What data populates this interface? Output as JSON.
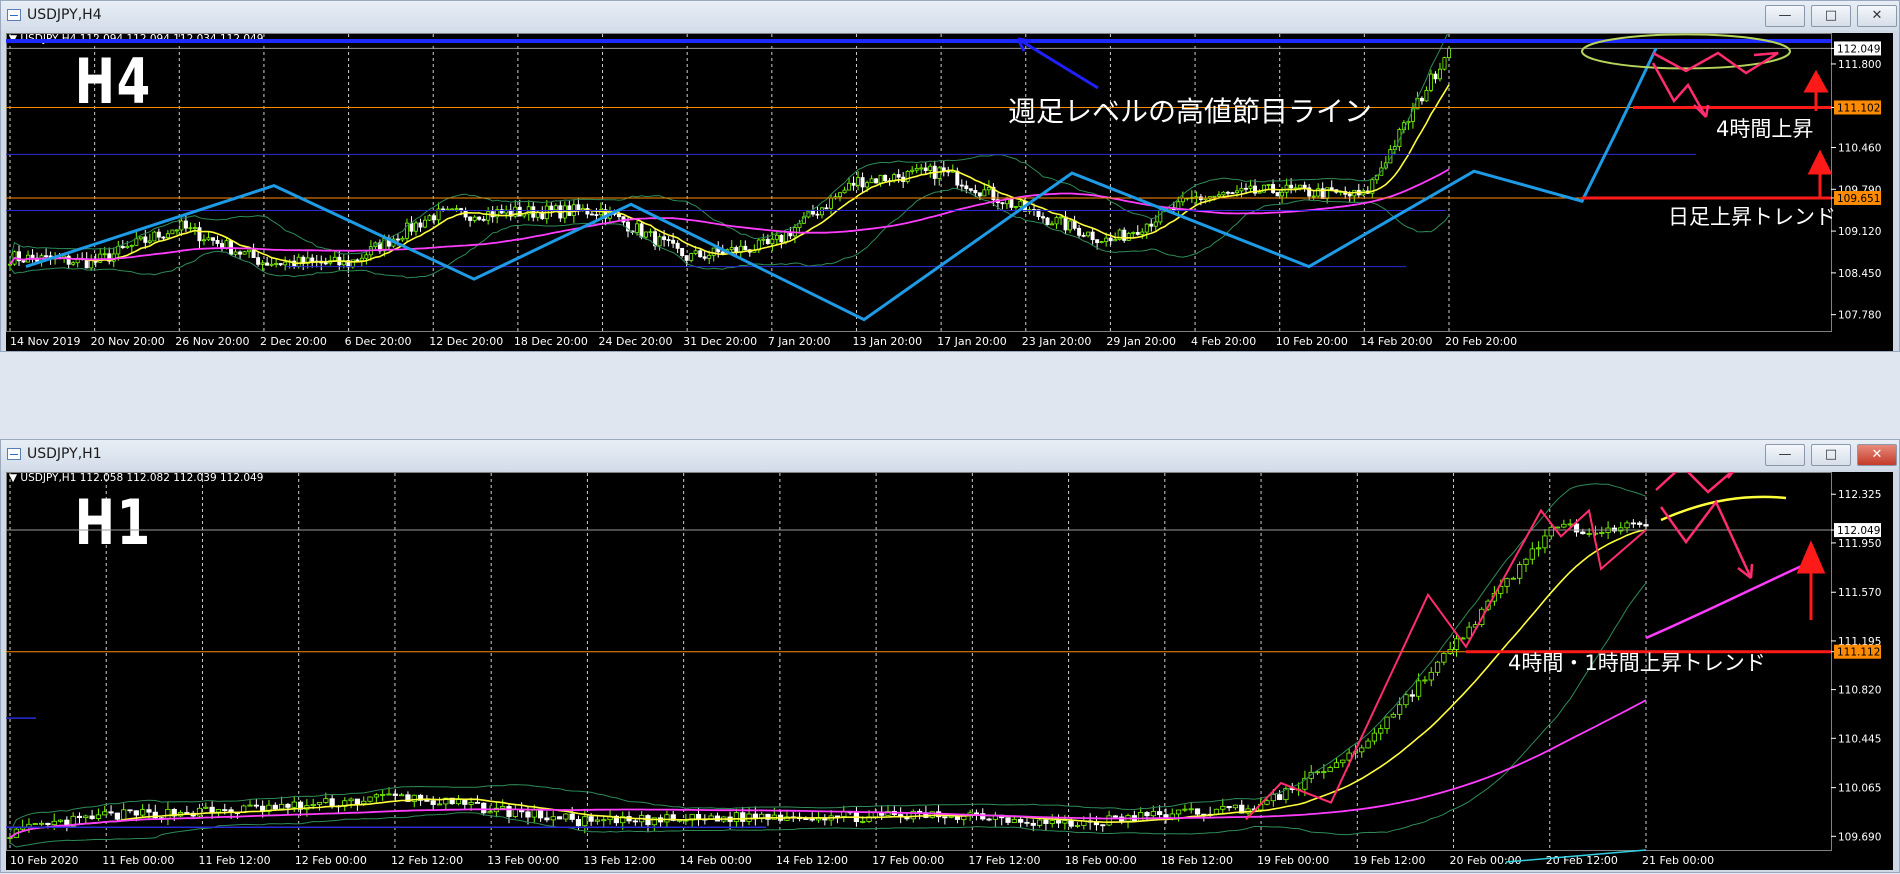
{
  "windows": [
    {
      "title": "USDJPY,H4",
      "info": "▼ USDJPY,H4  112.094 112.094 112.034 112.049",
      "label": "H4",
      "price_levels": [
        "112.049",
        "111.800",
        "111.102",
        "110.460",
        "109.790",
        "109.651",
        "109.120",
        "108.450",
        "107.780"
      ],
      "time_labels": [
        "14 Nov 2019",
        "20 Nov 20:00",
        "26 Nov 20:00",
        "2 Dec 20:00",
        "6 Dec 20:00",
        "12 Dec 20:00",
        "18 Dec 20:00",
        "24 Dec 20:00",
        "31 Dec 20:00",
        "7 Jan 20:00",
        "13 Jan 20:00",
        "17 Jan 20:00",
        "23 Jan 20:00",
        "29 Jan 20:00",
        "4 Feb 20:00",
        "10 Feb 20:00",
        "14 Feb 20:00",
        "20 Feb 20:00"
      ],
      "annotations": [
        "週足レベルの高値節目ライン",
        "4時間上昇",
        "日足上昇トレンド"
      ]
    },
    {
      "title": "USDJPY,H1",
      "info": "▼ USDJPY,H1  112.058 112.082 112.039 112.049",
      "label": "H1",
      "price_levels": [
        "112.325",
        "112.049",
        "111.950",
        "111.570",
        "111.195",
        "111.112",
        "110.820",
        "110.445",
        "110.065",
        "109.690"
      ],
      "time_labels": [
        "10 Feb 2020",
        "11 Feb 00:00",
        "11 Feb 12:00",
        "12 Feb 00:00",
        "12 Feb 12:00",
        "13 Feb 00:00",
        "13 Feb 12:00",
        "14 Feb 00:00",
        "14 Feb 12:00",
        "17 Feb 00:00",
        "17 Feb 12:00",
        "18 Feb 00:00",
        "18 Feb 12:00",
        "19 Feb 00:00",
        "19 Feb 12:00",
        "20 Feb 00:00",
        "20 Feb 12:00",
        "21 Feb 00:00"
      ],
      "annotations": [
        "4時間・1時間上昇トレンド"
      ]
    }
  ],
  "colors": {
    "background": "#000000",
    "candle_up": "#7CFC00",
    "candle_down": "#FFFFFF",
    "ma_fast": "#FFFF3C",
    "ma_slow": "#FF3CFF",
    "bands": "#2E8B57",
    "zigzag": "#1E9BE6",
    "annotation_red": "#FF1A1A",
    "annotation_pink": "#FF2D6E"
  },
  "chart_data": [
    {
      "type": "candlestick",
      "symbol": "USDJPY",
      "timeframe": "H4",
      "ylim": [
        107.55,
        112.2
      ],
      "highlighted_levels": [
        112.049,
        111.102,
        109.651
      ],
      "series": [
        {
          "kind": "close",
          "x": [
            "14 Nov 2019",
            "20 Nov 20:00",
            "26 Nov 20:00",
            "2 Dec 20:00",
            "6 Dec 20:00",
            "12 Dec 20:00",
            "18 Dec 20:00",
            "24 Dec 20:00",
            "31 Dec 20:00",
            "7 Jan 20:00",
            "13 Jan 20:00",
            "17 Jan 20:00",
            "23 Jan 20:00",
            "29 Jan 20:00",
            "4 Feb 20:00",
            "10 Feb 20:00",
            "14 Feb 20:00",
            "20 Feb 20:00"
          ],
          "values": [
            108.7,
            108.62,
            109.2,
            108.62,
            108.6,
            109.38,
            109.42,
            109.45,
            108.7,
            108.9,
            109.92,
            110.08,
            109.45,
            108.95,
            109.65,
            109.78,
            109.68,
            112.05
          ]
        }
      ]
    },
    {
      "type": "candlestick",
      "symbol": "USDJPY",
      "timeframe": "H1",
      "ylim": [
        109.6,
        112.45
      ],
      "highlighted_levels": [
        112.049,
        111.112
      ],
      "series": [
        {
          "kind": "close",
          "x": [
            "10 Feb 2020",
            "11 Feb 00:00",
            "11 Feb 12:00",
            "12 Feb 00:00",
            "12 Feb 12:00",
            "13 Feb 00:00",
            "13 Feb 12:00",
            "14 Feb 00:00",
            "14 Feb 12:00",
            "17 Feb 00:00",
            "17 Feb 12:00",
            "18 Feb 00:00",
            "18 Feb 12:00",
            "19 Feb 00:00",
            "19 Feb 12:00",
            "20 Feb 00:00",
            "20 Feb 12:00",
            "21 Feb 00:00"
          ],
          "values": [
            109.72,
            109.85,
            109.88,
            109.92,
            110.0,
            109.9,
            109.8,
            109.82,
            109.85,
            109.84,
            109.86,
            109.78,
            109.86,
            109.92,
            110.35,
            111.15,
            112.05,
            112.08
          ]
        }
      ]
    }
  ]
}
